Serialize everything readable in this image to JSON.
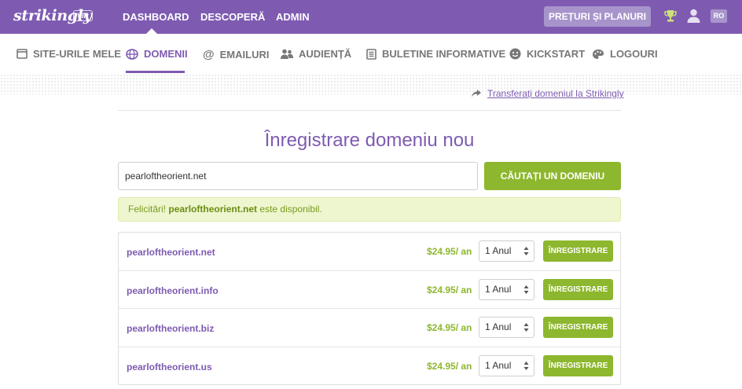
{
  "topbar": {
    "logo": "strikingly",
    "badge": "VIP",
    "nav": [
      "DASHBOARD",
      "DESCOPERĂ",
      "ADMIN"
    ],
    "pricing_button": "PREȚURI ȘI PLANURI",
    "language": "RO",
    "icons": [
      "trophy-icon",
      "user-icon"
    ]
  },
  "subnav": {
    "items": [
      {
        "label": "SITE-URILE MELE",
        "icon": "window-icon"
      },
      {
        "label": "DOMENII",
        "icon": "globe-icon",
        "active": true
      },
      {
        "label": "EMAILURI",
        "icon": "at-icon"
      },
      {
        "label": "AUDIENȚĂ",
        "icon": "people-icon"
      },
      {
        "label": "BULETINE INFORMATIVE",
        "icon": "newsletter-icon"
      },
      {
        "label": "KICKSTART",
        "icon": "smiley-icon"
      },
      {
        "label": "LOGOURI",
        "icon": "palette-icon"
      }
    ]
  },
  "transfer_link": "Transferați domeniul la Strikingly",
  "page_title": "Înregistrare domeniu nou",
  "search": {
    "value": "pearloftheorient.net",
    "button": "CĂUTAȚI UN DOMENIU"
  },
  "success": {
    "prefix": "Felicitări!",
    "domain": "pearloftheorient.net",
    "suffix": "este disponibil."
  },
  "results": [
    {
      "domain": "pearloftheorient.net",
      "price": "$24.95/ an",
      "term": "1 Anul",
      "button": "ÎNREGISTRARE"
    },
    {
      "domain": "pearloftheorient.info",
      "price": "$24.95/ an",
      "term": "1 Anul",
      "button": "ÎNREGISTRARE"
    },
    {
      "domain": "pearloftheorient.biz",
      "price": "$24.95/ an",
      "term": "1 Anul",
      "button": "ÎNREGISTRARE"
    },
    {
      "domain": "pearloftheorient.us",
      "price": "$24.95/ an",
      "term": "1 Anul",
      "button": "ÎNREGISTRARE"
    }
  ],
  "colors": {
    "brand_purple": "#7e5bb1",
    "accent_green": "#8db72e",
    "success_bg": "#eef6cf"
  }
}
